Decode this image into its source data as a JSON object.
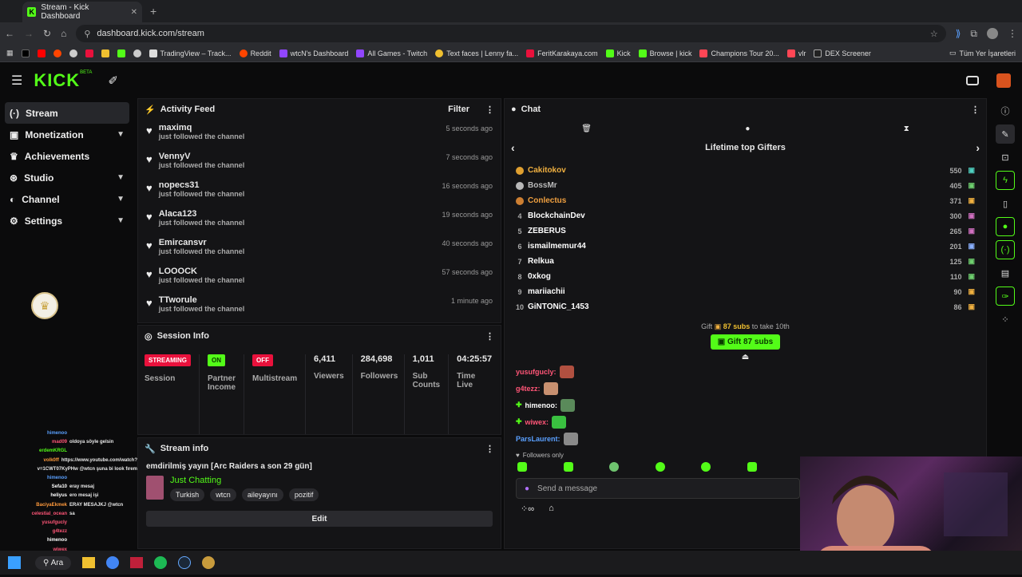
{
  "browser": {
    "tab_title": "Stream - Kick Dashboard",
    "url": "dashboard.kick.com/stream",
    "bookmarks": [
      "TradingView – Track...",
      "Reddit",
      "wtcN's Dashboard",
      "All Games - Twitch",
      "Text faces | Lenny fa...",
      "FeritKarakaya.com",
      "Kick",
      "Browse | kick",
      "Champions Tour 20...",
      "vlr",
      "DEX Screener"
    ],
    "all_bookmarks": "Tüm Yer İşaretleri"
  },
  "app": {
    "logo": "KICK",
    "beta": "BETA"
  },
  "sidebar": {
    "items": [
      {
        "label": "Stream",
        "icon": "broadcast-icon",
        "active": true
      },
      {
        "label": "Monetization",
        "icon": "money-icon",
        "chevron": true
      },
      {
        "label": "Achievements",
        "icon": "trophy-icon"
      },
      {
        "label": "Studio",
        "icon": "studio-icon",
        "chevron": true
      },
      {
        "label": "Channel",
        "icon": "channel-icon",
        "chevron": true
      },
      {
        "label": "Settings",
        "icon": "gear-icon",
        "chevron": true
      }
    ]
  },
  "activity_feed": {
    "title": "Activity Feed",
    "filter": "Filter",
    "items": [
      {
        "name": "maximq",
        "action": "just followed the channel",
        "time": "5 seconds ago"
      },
      {
        "name": "VennyV",
        "action": "just followed the channel",
        "time": "7 seconds ago"
      },
      {
        "name": "nopecs31",
        "action": "just followed the channel",
        "time": "16 seconds ago"
      },
      {
        "name": "Alaca123",
        "action": "just followed the channel",
        "time": "19 seconds ago"
      },
      {
        "name": "Emircansvr",
        "action": "just followed the channel",
        "time": "40 seconds ago"
      },
      {
        "name": "LOOOCK",
        "action": "just followed the channel",
        "time": "57 seconds ago"
      },
      {
        "name": "TTworule",
        "action": "just followed the channel",
        "time": "1 minute ago"
      }
    ]
  },
  "session_info": {
    "title": "Session Info",
    "streaming_badge": "STREAMING",
    "session_label": "Session",
    "on_badge": "ON",
    "partner_label1": "Partner",
    "partner_label2": "Income",
    "off_badge": "OFF",
    "multistream_label": "Multistream",
    "viewers": "6,411",
    "viewers_label": "Viewers",
    "followers": "284,698",
    "followers_label": "Followers",
    "subs": "1,011",
    "subs_label1": "Sub",
    "subs_label2": "Counts",
    "time": "04:25:57",
    "time_label1": "Time",
    "time_label2": "Live"
  },
  "stream_info": {
    "title": "Stream info",
    "stream_title": "emdirilmiş yayın [Arc Raiders a son 29 gün]",
    "category": "Just Chatting",
    "tags": [
      "Turkish",
      "wtcn",
      "aileyayını",
      "pozitif"
    ],
    "edit": "Edit"
  },
  "chat": {
    "title": "Chat",
    "leaderboard_title": "Lifetime top Gifters",
    "gifters": [
      {
        "rank": "1",
        "name": "Cakitokov",
        "value": "550",
        "medal": "#e0a030",
        "color": "#f0b040"
      },
      {
        "rank": "2",
        "name": "BossMr",
        "value": "405",
        "medal": "#b8b8b8",
        "color": "#bbbbbb"
      },
      {
        "rank": "3",
        "name": "Conlectus",
        "value": "371",
        "medal": "#cd7f32",
        "color": "#f0a040"
      },
      {
        "rank": "4",
        "name": "BlockchainDev",
        "value": "300",
        "color": "#ffffff"
      },
      {
        "rank": "5",
        "name": "ZEBERUS",
        "value": "265",
        "color": "#ffffff"
      },
      {
        "rank": "6",
        "name": "ismailmemur44",
        "value": "201",
        "color": "#ffffff"
      },
      {
        "rank": "7",
        "name": "Relkua",
        "value": "125",
        "color": "#ffffff"
      },
      {
        "rank": "8",
        "name": "0xkog",
        "value": "110",
        "color": "#ffffff"
      },
      {
        "rank": "9",
        "name": "mariiachii",
        "value": "90",
        "color": "#ffffff"
      },
      {
        "rank": "10",
        "name": "GiNTONiC_1453",
        "value": "86",
        "color": "#ffffff"
      }
    ],
    "gift_prompt_pre": "Gift",
    "gift_prompt_count": "87 subs",
    "gift_prompt_post": "to take 10th",
    "gift_button": "Gift 87 subs",
    "messages": [
      {
        "user": "yusufgucly:",
        "color": "#ff5577"
      },
      {
        "user": "g4tezz:",
        "color": "#ff5577"
      },
      {
        "user": "himenoo:",
        "color": "#ffffff"
      },
      {
        "user": "wiwex:",
        "color": "#ff5577"
      },
      {
        "user": "ParsLaurent:",
        "color": "#5aa0ff"
      }
    ],
    "followers_only": "Followers only",
    "input_placeholder": "Send a message"
  },
  "overlay_chat": [
    {
      "u": "himenoo",
      "m": ""
    },
    {
      "u": "mad09",
      "m": "oldoya söyle gelsin"
    },
    {
      "u": "erdemKRGL",
      "m": ""
    },
    {
      "u": "volk0ff",
      "m": "https://www.youtube.com/watch?"
    },
    {
      "u": "",
      "m": "v=1CWT07KyPHw @wtcn şuna bi look fırem"
    },
    {
      "u": "himenoo",
      "m": ""
    },
    {
      "u": "Sefa10",
      "m": "eray mesaj"
    },
    {
      "u": "heliyus",
      "m": "ero mesaj işi"
    },
    {
      "u": "BaciyaEkmek",
      "m": "ERAY MESAJKJ @wtcn"
    },
    {
      "u": "celestial_ocean",
      "m": "sa"
    },
    {
      "u": "yusufgucly",
      "m": ""
    },
    {
      "u": "g4tezz",
      "m": ""
    },
    {
      "u": "himenoo",
      "m": ""
    },
    {
      "u": "wiwex",
      "m": ""
    },
    {
      "u": "ParsLaurent",
      "m": ""
    }
  ],
  "taskbar": {
    "search": "Ara"
  },
  "colors": {
    "accent": "#53fc18",
    "red": "#e9113c",
    "bg": "#0b0b0c",
    "panel": "#141416"
  }
}
